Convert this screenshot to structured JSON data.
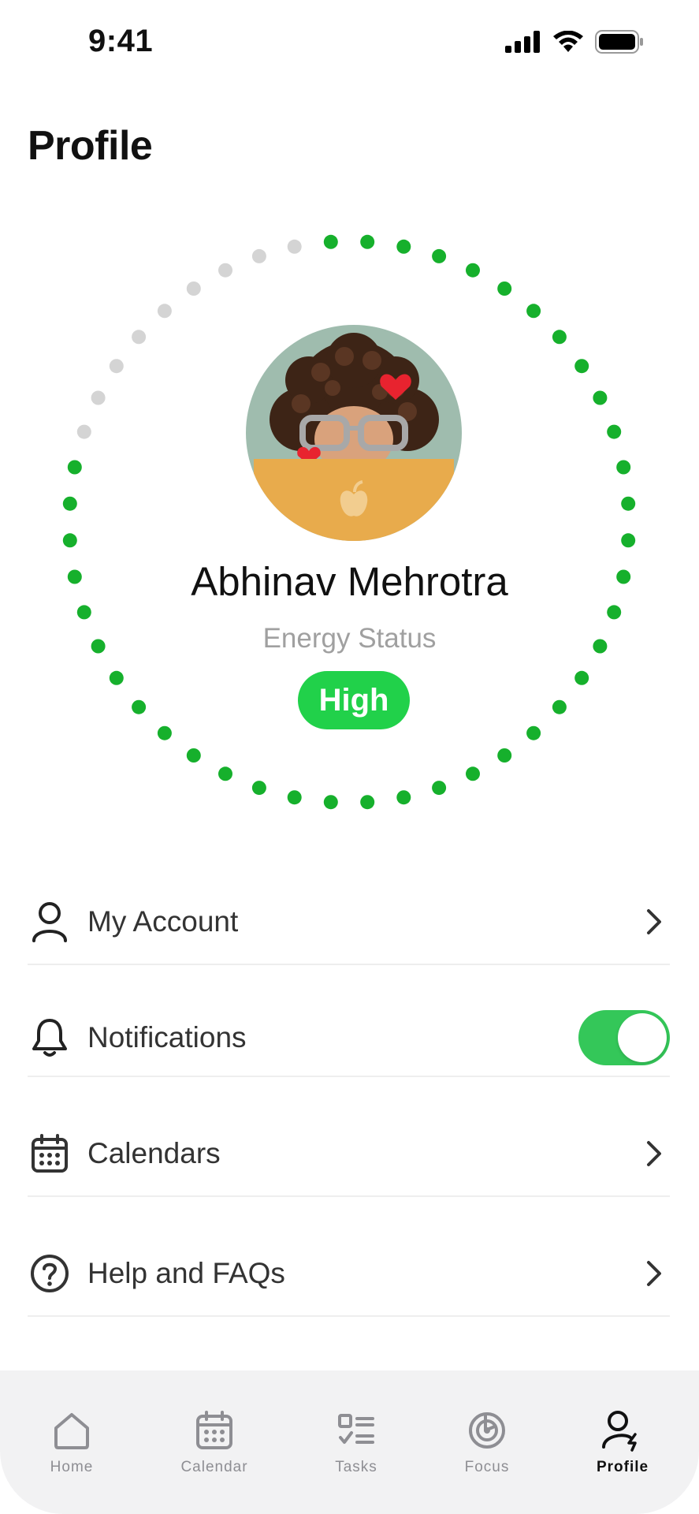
{
  "status_bar": {
    "time": "9:41",
    "icons": [
      "cellular-signal-icon",
      "wifi-icon",
      "battery-icon"
    ]
  },
  "page": {
    "title": "Profile"
  },
  "profile": {
    "name": "Abhinav Mehrotra",
    "energy_label": "Energy Status",
    "energy_value": "High",
    "energy_ring": {
      "total_dots": 48,
      "filled_dots": 39,
      "filled_color": "#16b02c",
      "empty_color": "#d4d4d4"
    },
    "avatar_icon": "memoji-avatar-icon"
  },
  "colors": {
    "accent_green": "#21d14a",
    "toggle_on": "#34c759",
    "tab_bar_bg": "#f2f2f3"
  },
  "settings": [
    {
      "label": "My Account",
      "icon": "person-icon",
      "control": "chevron"
    },
    {
      "label": "Notifications",
      "icon": "bell-icon",
      "control": "toggle",
      "value": true
    },
    {
      "label": "Calendars",
      "icon": "calendar-icon",
      "control": "chevron"
    },
    {
      "label": "Help and FAQs",
      "icon": "question-circle-icon",
      "control": "chevron"
    }
  ],
  "tabs": [
    {
      "label": "Home",
      "icon": "home-icon",
      "active": false
    },
    {
      "label": "Calendar",
      "icon": "calendar-icon",
      "active": false
    },
    {
      "label": "Tasks",
      "icon": "tasks-icon",
      "active": false
    },
    {
      "label": "Focus",
      "icon": "focus-icon",
      "active": false
    },
    {
      "label": "Profile",
      "icon": "profile-bolt-icon",
      "active": true
    }
  ]
}
